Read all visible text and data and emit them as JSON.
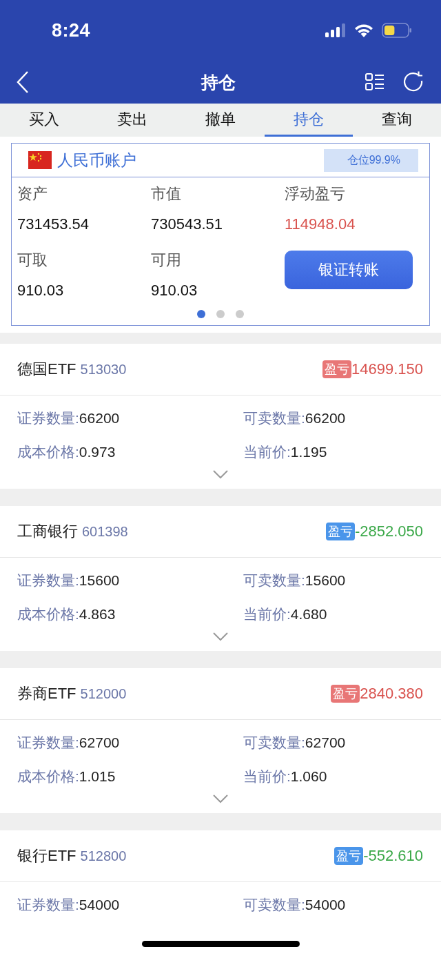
{
  "status_bar": {
    "time": "8:24"
  },
  "nav": {
    "title": "持仓"
  },
  "tabs": [
    {
      "label": "买入",
      "selected": false
    },
    {
      "label": "卖出",
      "selected": false
    },
    {
      "label": "撤单",
      "selected": false
    },
    {
      "label": "持仓",
      "selected": true
    },
    {
      "label": "查询",
      "selected": false
    }
  ],
  "account": {
    "name": "人民币账户",
    "position_badge": "仓位99.9%",
    "stats": [
      {
        "label": "资产",
        "value": "731453.54",
        "kind": "plain"
      },
      {
        "label": "市值",
        "value": "730543.51",
        "kind": "plain"
      },
      {
        "label": "浮动盈亏",
        "value": "114948.04",
        "kind": "gain"
      },
      {
        "label": "可取",
        "value": "910.03",
        "kind": "plain"
      },
      {
        "label": "可用",
        "value": "910.03",
        "kind": "plain"
      }
    ],
    "transfer_button": "银证转账",
    "pager": [
      {
        "selected": true
      },
      {
        "selected": false
      },
      {
        "selected": false
      }
    ]
  },
  "holdings": [
    {
      "name": "德国ETF",
      "code": "513030",
      "pl_label": "盈亏",
      "pl_value": "14699.150",
      "kind": "gain",
      "expand_toggle": true,
      "fields": [
        {
          "label": "证券数量:",
          "value": "66200"
        },
        {
          "label": "可卖数量:",
          "value": "66200"
        },
        {
          "label": "成本价格:",
          "value": "0.973"
        },
        {
          "label": "当前价:",
          "value": "1.195"
        }
      ]
    },
    {
      "name": "工商银行",
      "code": "601398",
      "pl_label": "盈亏",
      "pl_value": "-2852.050",
      "kind": "loss",
      "expand_toggle": true,
      "fields": [
        {
          "label": "证券数量:",
          "value": "15600"
        },
        {
          "label": "可卖数量:",
          "value": "15600"
        },
        {
          "label": "成本价格:",
          "value": "4.863"
        },
        {
          "label": "当前价:",
          "value": "4.680"
        }
      ]
    },
    {
      "name": "券商ETF",
      "code": "512000",
      "pl_label": "盈亏",
      "pl_value": "2840.380",
      "kind": "gain",
      "expand_toggle": true,
      "fields": [
        {
          "label": "证券数量:",
          "value": "62700"
        },
        {
          "label": "可卖数量:",
          "value": "62700"
        },
        {
          "label": "成本价格:",
          "value": "1.015"
        },
        {
          "label": "当前价:",
          "value": "1.060"
        }
      ]
    },
    {
      "name": "银行ETF",
      "code": "512800",
      "pl_label": "盈亏",
      "pl_value": "-552.610",
      "kind": "loss",
      "expand_toggle": false,
      "fields": [
        {
          "label": "证券数量:",
          "value": "54000"
        },
        {
          "label": "可卖数量:",
          "value": "54000"
        }
      ]
    }
  ]
}
